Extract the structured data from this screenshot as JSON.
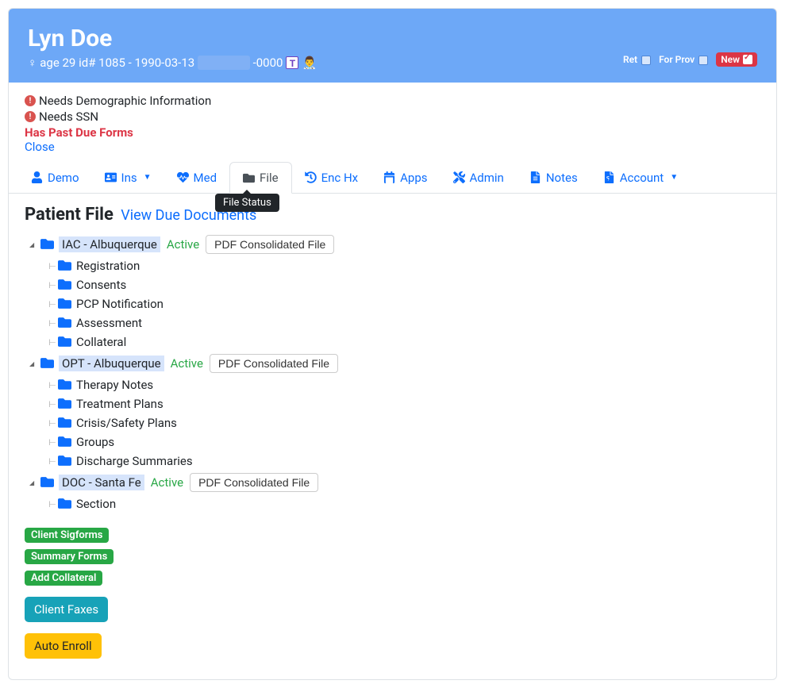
{
  "header": {
    "name": "Lyn Doe",
    "meta_prefix": "age 29 id# 1085 - 1990-03-13",
    "meta_suffix": "-0000",
    "t_icon": "T"
  },
  "header_right": {
    "ret": "Ret",
    "for_prov": "For Prov",
    "new": "New"
  },
  "alerts": {
    "a1": "Needs Demographic Information",
    "a2": "Needs SSN",
    "pastdue": "Has Past Due Forms",
    "close": "Close"
  },
  "tabs": {
    "demo": "Demo",
    "ins": "Ins",
    "med": "Med",
    "file": "File",
    "enchx": "Enc Hx",
    "apps": "Apps",
    "admin": "Admin",
    "notes": "Notes",
    "account": "Account"
  },
  "tooltip": "File Status",
  "section": {
    "title": "Patient File",
    "link": "View Due Documents"
  },
  "tree": {
    "r1": {
      "label": "IAC - Albuquerque",
      "status": "Active",
      "pdf": "PDF Consolidated File"
    },
    "c1": "Registration",
    "c2": "Consents",
    "c3": "PCP Notification",
    "c4": "Assessment",
    "c5": "Collateral",
    "r2": {
      "label": "OPT - Albuquerque",
      "status": "Active",
      "pdf": "PDF Consolidated File"
    },
    "c6": "Therapy Notes",
    "c7": "Treatment Plans",
    "c8": "Crisis/Safety Plans",
    "c9": "Groups",
    "c10": "Discharge Summaries",
    "r3": {
      "label": "DOC - Santa Fe",
      "status": "Active",
      "pdf": "PDF Consolidated File"
    },
    "c11": "Section"
  },
  "buttons": {
    "sig": "Client Sigforms",
    "sum": "Summary Forms",
    "addcol": "Add Collateral",
    "faxes": "Client Faxes",
    "auto": "Auto Enroll"
  }
}
